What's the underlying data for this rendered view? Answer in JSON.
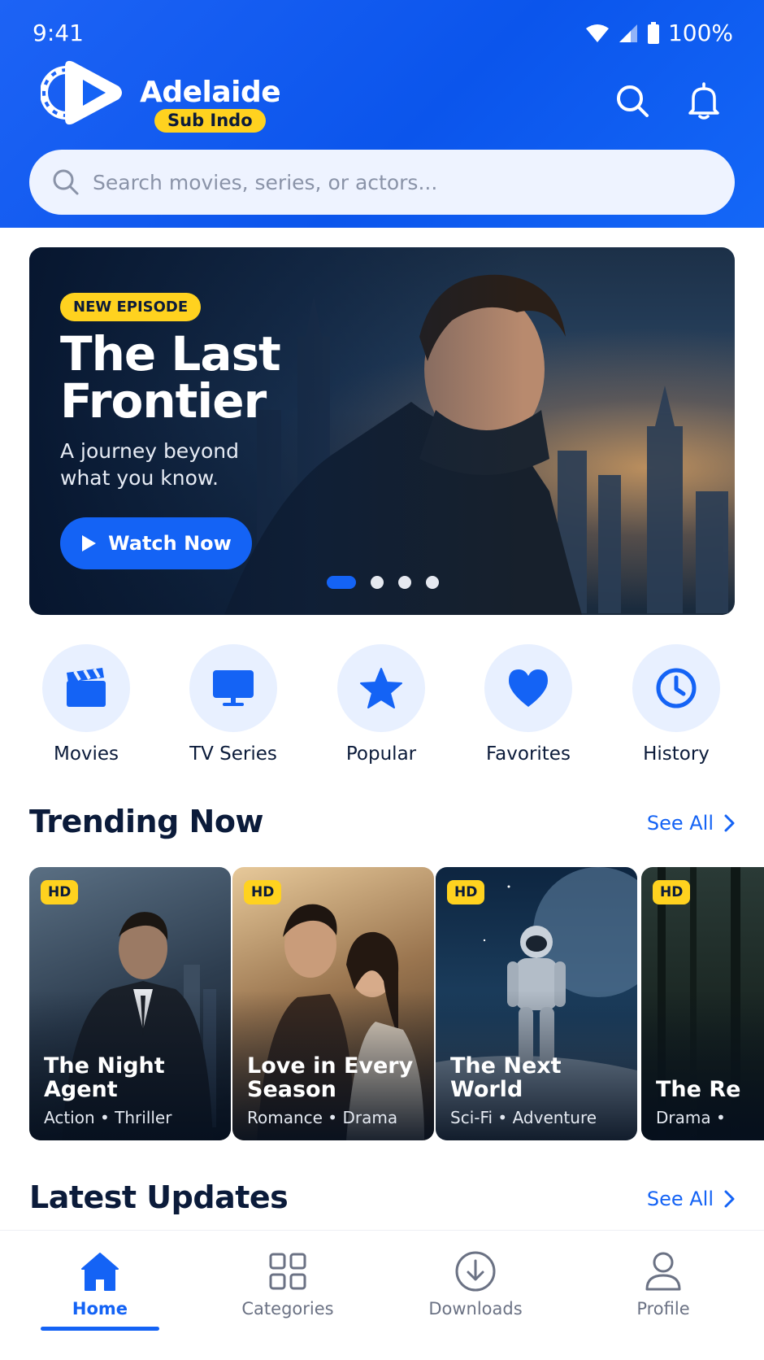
{
  "status_bar": {
    "time": "9:41",
    "battery": "100%"
  },
  "brand": {
    "name": "Adelaide",
    "badge": "Sub Indo"
  },
  "search": {
    "placeholder": "Search movies, series, or actors..."
  },
  "hero": {
    "badge": "NEW EPISODE",
    "title": "The Last Frontier",
    "subtitle": "A journey beyond what you know.",
    "cta_label": "Watch Now",
    "slides_count": 4,
    "active_slide": 1
  },
  "categories": [
    {
      "label": "Movies",
      "icon": "clapperboard-icon"
    },
    {
      "label": "TV Series",
      "icon": "tv-icon"
    },
    {
      "label": "Popular",
      "icon": "star-icon"
    },
    {
      "label": "Favorites",
      "icon": "heart-icon"
    },
    {
      "label": "History",
      "icon": "clock-icon"
    }
  ],
  "trending": {
    "title": "Trending Now",
    "see_all": "See All",
    "items": [
      {
        "badge": "HD",
        "title": "The Night Agent",
        "genres": "Action • Thriller"
      },
      {
        "badge": "HD",
        "title": "Love in Every Season",
        "genres": "Romance • Drama"
      },
      {
        "badge": "HD",
        "title": "The Next World",
        "genres": "Sci-Fi • Adventure"
      },
      {
        "badge": "HD",
        "title": "The Re",
        "genres": "Drama •"
      }
    ]
  },
  "latest": {
    "title": "Latest Updates",
    "see_all": "See All"
  },
  "bottom_nav": {
    "items": [
      {
        "label": "Home",
        "icon": "home-icon"
      },
      {
        "label": "Categories",
        "icon": "grid-icon"
      },
      {
        "label": "Downloads",
        "icon": "download-icon"
      },
      {
        "label": "Profile",
        "icon": "profile-icon"
      }
    ],
    "active": "Home"
  },
  "colors": {
    "primary": "#1463f5",
    "accent": "#ffd21f",
    "text": "#0b1b3a",
    "muted": "#6b7284"
  }
}
